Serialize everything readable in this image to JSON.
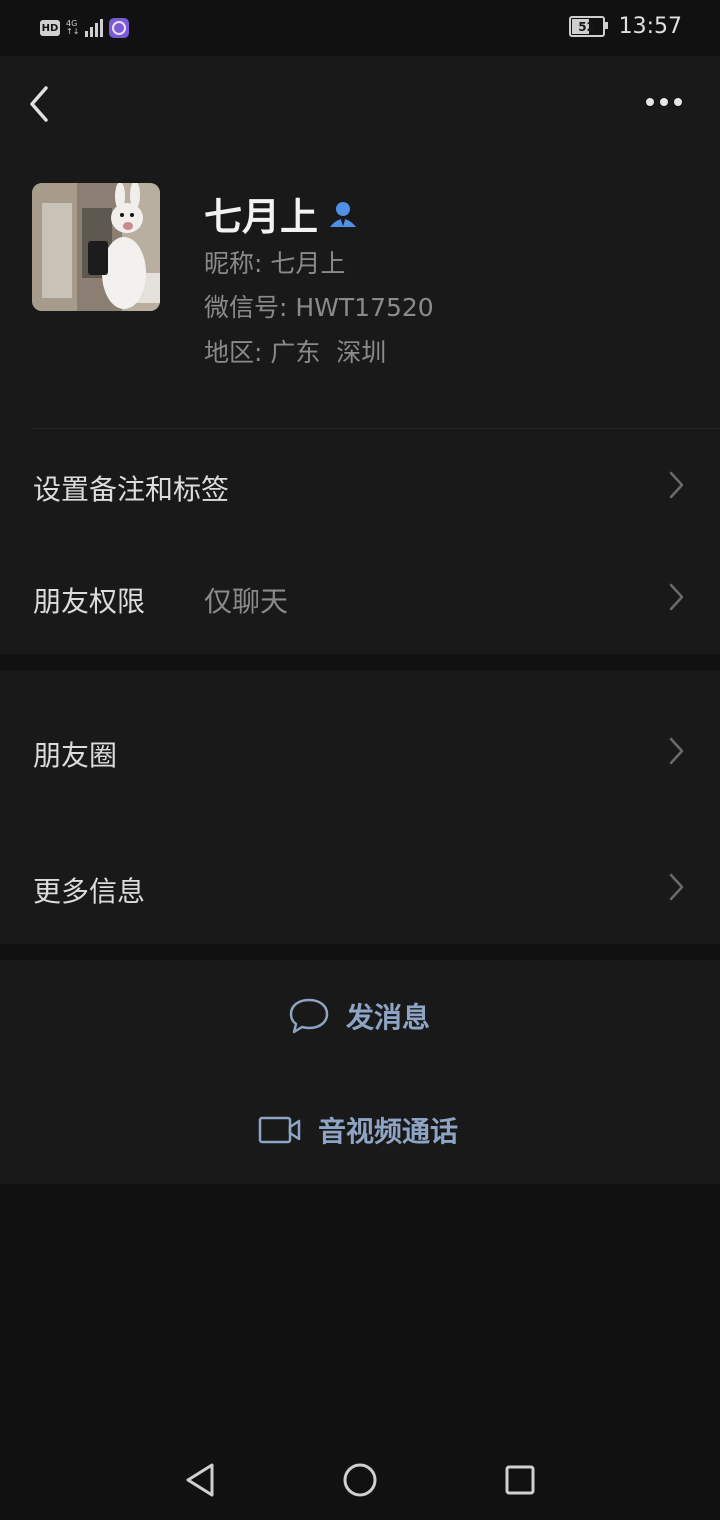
{
  "status_bar": {
    "hd": "HD",
    "network_top": "4G",
    "network_bottom": "↑↓",
    "battery": "52",
    "time": "13:57"
  },
  "header": {
    "back_icon": "chevron-left-icon",
    "more_icon": "more-horizontal-icon"
  },
  "profile": {
    "name": "七月上",
    "contact_icon": "person-icon",
    "nickname_label": "昵称: ",
    "nickname": "七月上",
    "wechat_id_label": "微信号: ",
    "wechat_id": "HWT17520",
    "region_label": "地区: ",
    "region": "广东  深圳"
  },
  "menu": {
    "set_remark": "设置备注和标签",
    "friend_permissions": "朋友权限",
    "friend_permissions_value": "仅聊天",
    "moments": "朋友圈",
    "more_info": "更多信息"
  },
  "actions": {
    "send_message": "发消息",
    "send_message_icon": "chat-bubble-icon",
    "av_call": "音视频通话",
    "av_call_icon": "video-camera-icon"
  },
  "colors": {
    "background": "#111111",
    "panel": "#191919",
    "action_text": "#8ea4c4",
    "contact_icon": "#4f90e8"
  }
}
